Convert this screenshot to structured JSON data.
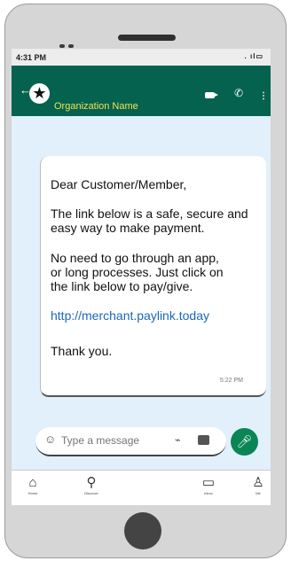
{
  "status_bar": {
    "time": "4:31 PM",
    "signal": ". ıl▭"
  },
  "header": {
    "back_icon": "back-arrow-icon",
    "org_name": "Organization Name"
  },
  "message": {
    "greeting": "Dear Customer/Member,",
    "para1_line1": "The link below is a safe, secure and",
    "para1_line2": "easy way to make payment.",
    "para2_line1": "No need to go through an app,",
    "para2_line2": "or long processes. Just click on",
    "para2_line3": "the link below to pay/give.",
    "link": "http://merchant.paylink.today",
    "closing": "Thank you.",
    "time": "5:22 PM"
  },
  "composer": {
    "placeholder": "Type a message"
  },
  "nav": {
    "home": "Home",
    "discover": "Discover",
    "inbox": "Inbox",
    "me": "Me"
  },
  "colors": {
    "header_bg": "#05624f",
    "accent_green": "#0b8556",
    "org_name": "#f2e34a",
    "link": "#1b67b8"
  }
}
